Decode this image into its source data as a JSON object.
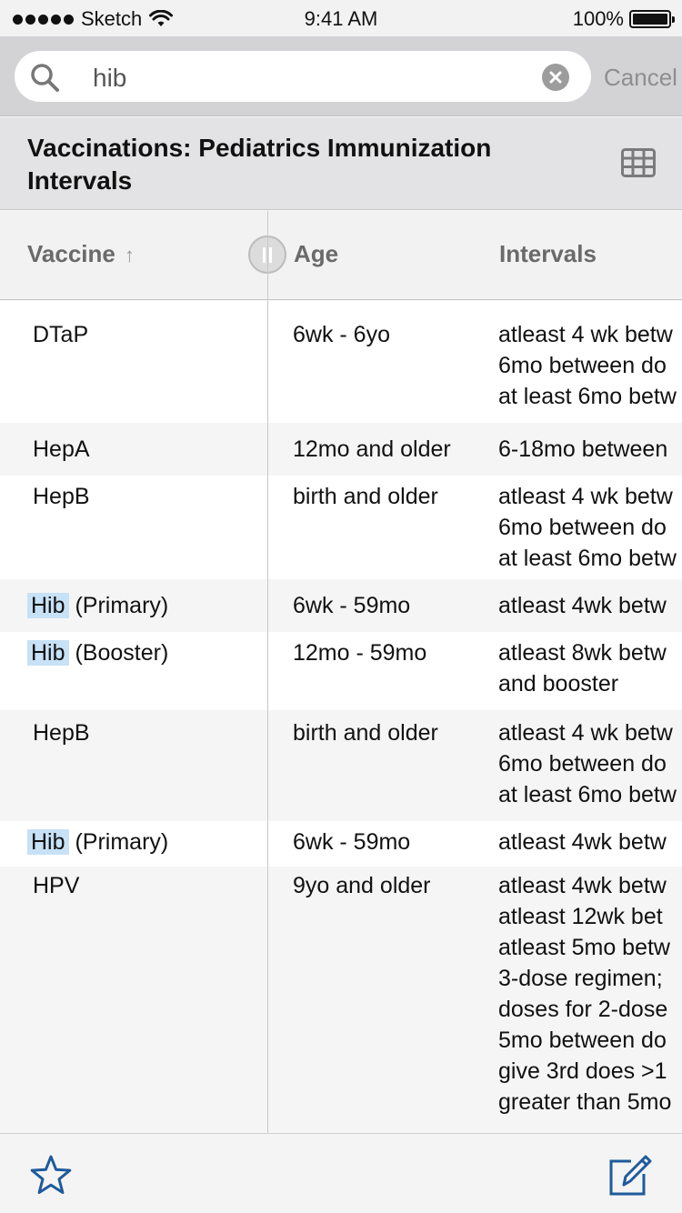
{
  "status_bar": {
    "carrier": "Sketch",
    "time": "9:41 AM",
    "battery": "100%"
  },
  "search": {
    "value": "hib",
    "cancel_label": "Cancel"
  },
  "page": {
    "title": "Vaccinations: Pediatrics Immunization Intervals"
  },
  "table": {
    "headers": {
      "vaccine": "Vaccine",
      "sort_indicator": "↑",
      "age": "Age",
      "intervals": "Intervals"
    },
    "rows": [
      {
        "vaccine": "DTaP",
        "age": "6wk - 6yo",
        "intervals": [
          "atleast 4 wk betw",
          "6mo between do",
          "at least 6mo betw"
        ]
      },
      {
        "vaccine": "HepA",
        "age": "12mo and older",
        "intervals": [
          "6-18mo between"
        ]
      },
      {
        "vaccine": "HepB",
        "age": "birth and older",
        "intervals": [
          "atleast 4 wk betw",
          "6mo between do",
          "at least 6mo betw"
        ]
      },
      {
        "vaccine_highlight": "Hib",
        "vaccine_rest": " (Primary)",
        "age": "6wk - 59mo",
        "intervals": [
          "atleast 4wk betw"
        ]
      },
      {
        "vaccine_highlight": "Hib",
        "vaccine_rest": " (Booster)",
        "age": "12mo - 59mo",
        "intervals": [
          "atleast 8wk betw",
          "and booster"
        ]
      },
      {
        "vaccine": "HepB",
        "age": "birth and older",
        "intervals": [
          "atleast 4 wk betw",
          "6mo between do",
          "at least 6mo betw"
        ]
      },
      {
        "vaccine_highlight": "Hib",
        "vaccine_rest": " (Primary)",
        "age": "6wk - 59mo",
        "intervals": [
          "atleast 4wk betw"
        ]
      },
      {
        "vaccine": "HPV",
        "age": "9yo and older",
        "intervals": [
          "atleast 4wk betw",
          "atleast 12wk bet",
          "atleast 5mo betw",
          "3-dose regimen;",
          "doses for 2-dose",
          "5mo between do",
          "give 3rd does >1",
          "greater than 5mo"
        ]
      }
    ]
  },
  "icons": {
    "search": "search-icon",
    "clear": "clear-icon",
    "grid": "grid-icon",
    "favorite": "star-icon",
    "edit": "edit-icon"
  },
  "colors": {
    "accent": "#1e5a9c",
    "highlight": "#c7e1f6"
  }
}
